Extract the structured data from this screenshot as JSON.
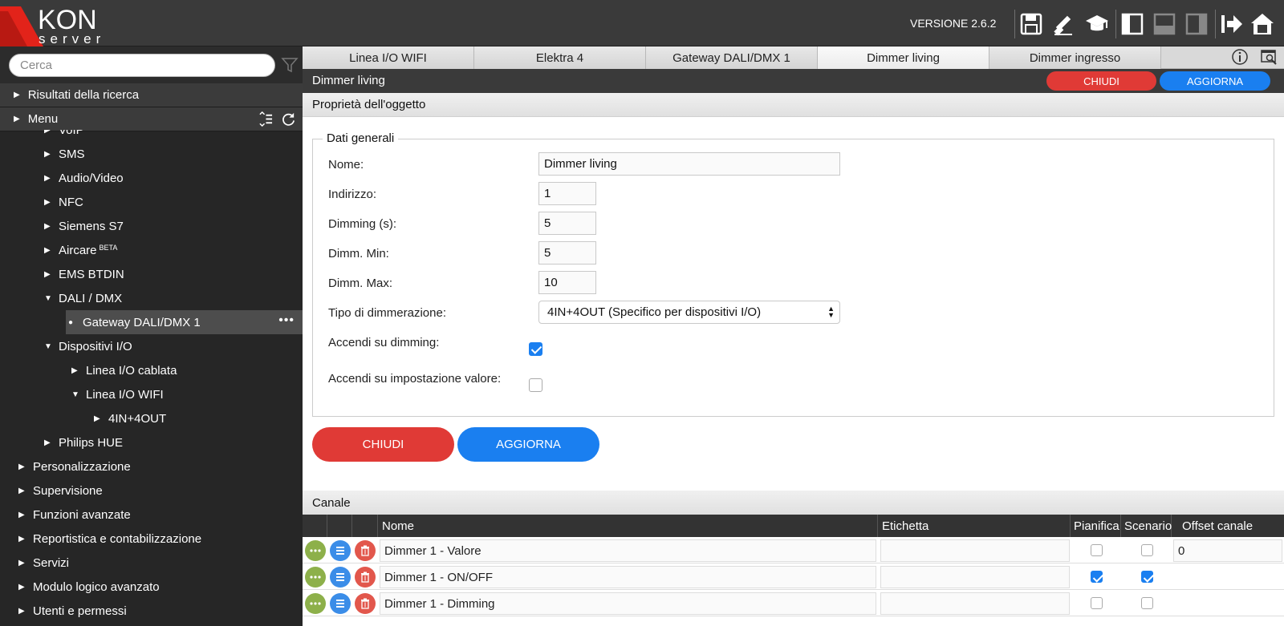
{
  "app": {
    "logo_text_top": "KON",
    "logo_text_bottom": "server",
    "version": "VERSIONE 2.6.2",
    "toolbar_icons": [
      "save-icon",
      "brush-icon",
      "graduation-cap-icon",
      "layout-left-icon",
      "layout-bottom-icon",
      "layout-right-icon",
      "logout-arrow-icon",
      "home-icon"
    ]
  },
  "sidebar": {
    "search_placeholder": "Cerca",
    "sections": [
      {
        "label": "Risultati della ricerca"
      },
      {
        "label": "Menu"
      }
    ],
    "tree": [
      {
        "label": "VoIP",
        "arrow": "▶"
      },
      {
        "label": "SMS",
        "arrow": "▶"
      },
      {
        "label": "Audio/Video",
        "arrow": "▶"
      },
      {
        "label": "NFC",
        "arrow": "▶"
      },
      {
        "label": "Siemens S7",
        "arrow": "▶"
      },
      {
        "label": "Aircare",
        "sup": "BETA",
        "arrow": "▶"
      },
      {
        "label": "EMS BTDIN",
        "arrow": "▶"
      },
      {
        "label": "DALI / DMX",
        "arrow": "▼"
      },
      {
        "label": "Gateway DALI/DMX 1",
        "arrow": "●"
      },
      {
        "label": "Dispositivi I/O",
        "arrow": "▼"
      },
      {
        "label": "Linea I/O cablata",
        "arrow": "▶"
      },
      {
        "label": "Linea I/O WIFI",
        "arrow": "▼"
      },
      {
        "label": "4IN+4OUT",
        "arrow": "▶"
      },
      {
        "label": "Philips HUE",
        "arrow": "▶"
      },
      {
        "label": "Personalizzazione",
        "arrow": "▶"
      },
      {
        "label": "Supervisione",
        "arrow": "▶"
      },
      {
        "label": "Funzioni avanzate",
        "arrow": "▶"
      },
      {
        "label": "Reportistica e contabilizzazione",
        "arrow": "▶"
      },
      {
        "label": "Servizi",
        "arrow": "▶"
      },
      {
        "label": "Modulo logico avanzato",
        "arrow": "▶"
      },
      {
        "label": "Utenti e permessi",
        "arrow": "▶"
      }
    ],
    "selected_dots": "•••"
  },
  "tabs": [
    {
      "label": "Linea I/O WIFI"
    },
    {
      "label": "Elektra 4"
    },
    {
      "label": "Gateway DALI/DMX 1"
    },
    {
      "label": "Dimmer living"
    },
    {
      "label": "Dimmer ingresso"
    }
  ],
  "panel": {
    "title": "Dimmer living",
    "close_label": "CHIUDI",
    "update_label": "AGGIORNA",
    "properties_header": "Proprietà dell'oggetto",
    "fieldset_legend": "Dati generali",
    "fields": {
      "name_label": "Nome:",
      "name_value": "Dimmer living",
      "address_label": "Indirizzo:",
      "address_value": "1",
      "dimming_label": "Dimming (s):",
      "dimming_value": "5",
      "dimm_min_label": "Dimm. Min:",
      "dimm_min_value": "5",
      "dimm_max_label": "Dimm. Max:",
      "dimm_max_value": "10",
      "type_label": "Tipo di dimmerazione:",
      "type_value": "4IN+4OUT (Specifico per dispositivi I/O)",
      "on_dimming_label": "Accendi su dimming:",
      "on_dimming_checked": true,
      "on_value_label": "Accendi su impostazione valore:",
      "on_value_checked": false
    }
  },
  "channel": {
    "header": "Canale",
    "columns": {
      "nome": "Nome",
      "etichetta": "Etichetta",
      "pianifica": "Pianifica",
      "scenario": "Scenario",
      "offset": "Offset canale"
    },
    "rows": [
      {
        "nome": "Dimmer 1 - Valore",
        "etichetta": "",
        "pianifica": false,
        "scenario": false,
        "offset": "0"
      },
      {
        "nome": "Dimmer 1 - ON/OFF",
        "etichetta": "",
        "pianifica": true,
        "scenario": true,
        "offset": ""
      },
      {
        "nome": "Dimmer 1 - Dimming",
        "etichetta": "",
        "pianifica": false,
        "scenario": false,
        "offset": ""
      }
    ]
  },
  "colors": {
    "red": "#e03a36",
    "blue": "#1a7ff0",
    "green": "#8db04a",
    "logo_red": "#e2231a"
  }
}
